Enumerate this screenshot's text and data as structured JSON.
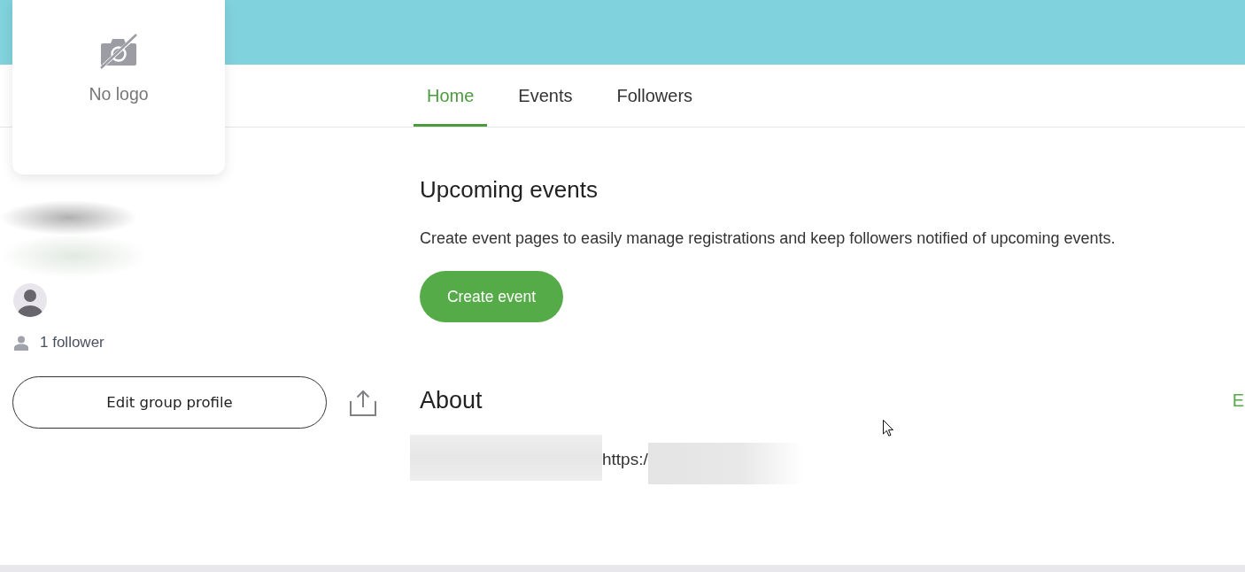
{
  "header": {
    "logo_placeholder": "No logo"
  },
  "tabs": [
    {
      "label": "Home",
      "selected": true
    },
    {
      "label": "Events",
      "selected": false
    },
    {
      "label": "Followers",
      "selected": false
    }
  ],
  "profile": {
    "followers": "1 follower",
    "edit_button": "Edit group profile"
  },
  "upcoming_events": {
    "title": "Upcoming events",
    "description": "Create event pages to easily manage registrations and keep followers notified of upcoming events.",
    "button": "Create event"
  },
  "about": {
    "title": "About",
    "action": "E",
    "link": "https:/"
  }
}
